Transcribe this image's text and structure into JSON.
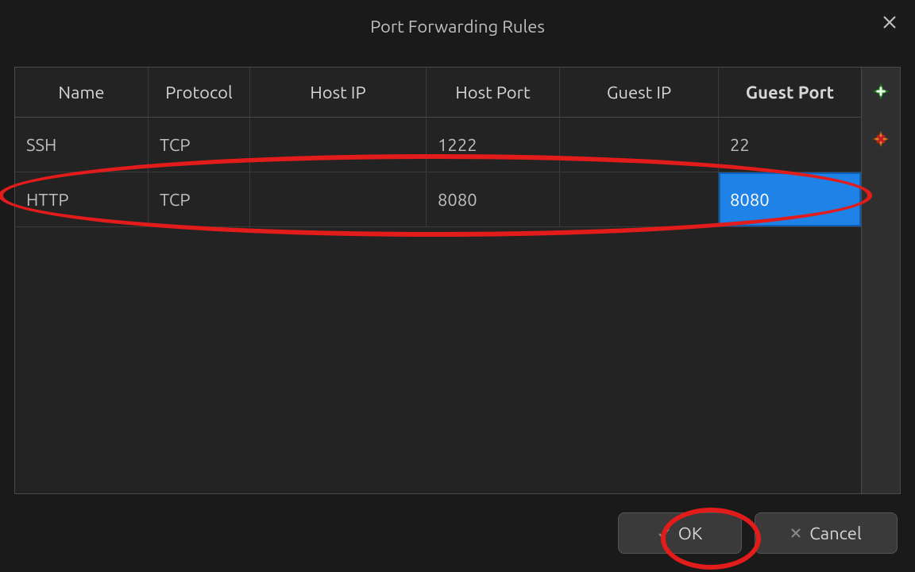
{
  "window": {
    "title": "Port Forwarding Rules"
  },
  "table": {
    "columns": {
      "name": "Name",
      "protocol": "Protocol",
      "host_ip": "Host IP",
      "host_port": "Host Port",
      "guest_ip": "Guest IP",
      "guest_port": "Guest Port"
    },
    "sorted_column": "guest_port",
    "rows": [
      {
        "name": "SSH",
        "protocol": "TCP",
        "host_ip": "",
        "host_port": "1222",
        "guest_ip": "",
        "guest_port": "22",
        "selected_cell": null
      },
      {
        "name": "HTTP",
        "protocol": "TCP",
        "host_ip": "",
        "host_port": "8080",
        "guest_ip": "",
        "guest_port": "8080",
        "selected_cell": "guest_port"
      }
    ]
  },
  "toolbar": {
    "add_tooltip": "Add rule",
    "remove_tooltip": "Remove rule"
  },
  "footer": {
    "ok_label": "OK",
    "cancel_label": "Cancel"
  },
  "colors": {
    "selection": "#1f82e6",
    "annotation": "#e21b1b"
  }
}
